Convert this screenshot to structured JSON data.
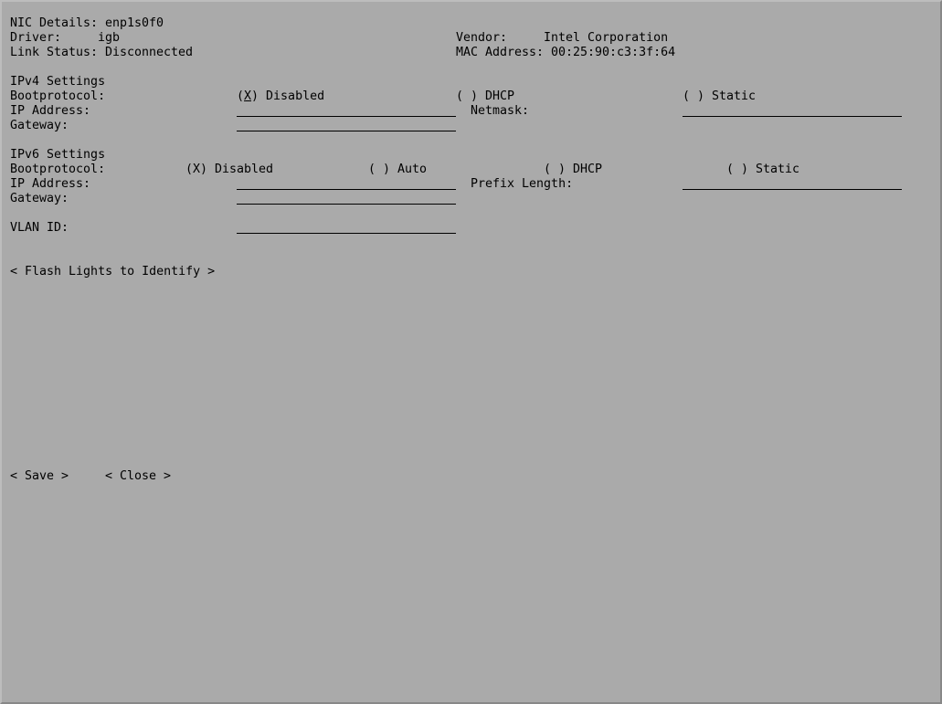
{
  "nic": {
    "details_label": "NIC Details:",
    "details_value": "enp1s0f0",
    "driver_label": "Driver:",
    "driver_value": "igb",
    "link_status_label": "Link Status:",
    "link_status_value": "Disconnected",
    "vendor_label": "Vendor:",
    "vendor_value": "Intel Corporation",
    "mac_label": "MAC Address:",
    "mac_value": "00:25:90:c3:3f:64"
  },
  "ipv4": {
    "heading": "IPv4 Settings",
    "bootprotocol_label": "Bootprotocol:",
    "options": [
      {
        "mark": "(",
        "cursor": "X",
        "rest": ") Disabled",
        "selected": true
      },
      {
        "text": "( ) DHCP",
        "selected": false
      },
      {
        "text": "( ) Static",
        "selected": false
      }
    ],
    "ip_label": "IP Address:",
    "ip_value": "",
    "netmask_label": "Netmask:",
    "netmask_value": "",
    "gateway_label": "Gateway:",
    "gateway_value": ""
  },
  "ipv6": {
    "heading": "IPv6 Settings",
    "bootprotocol_label": "Bootprotocol:",
    "options": [
      {
        "text": "(X) Disabled",
        "selected": true
      },
      {
        "text": "( ) Auto",
        "selected": false
      },
      {
        "text": "( ) DHCP",
        "selected": false
      },
      {
        "text": "( ) Static",
        "selected": false
      }
    ],
    "ip_label": "IP Address:",
    "ip_value": "",
    "prefix_label": "Prefix Length:",
    "prefix_value": "",
    "gateway_label": "Gateway:",
    "gateway_value": ""
  },
  "vlan": {
    "label": "VLAN ID:",
    "value": ""
  },
  "buttons": {
    "flash": "< Flash Lights to Identify >",
    "save": "< Save >",
    "close": "< Close >"
  }
}
